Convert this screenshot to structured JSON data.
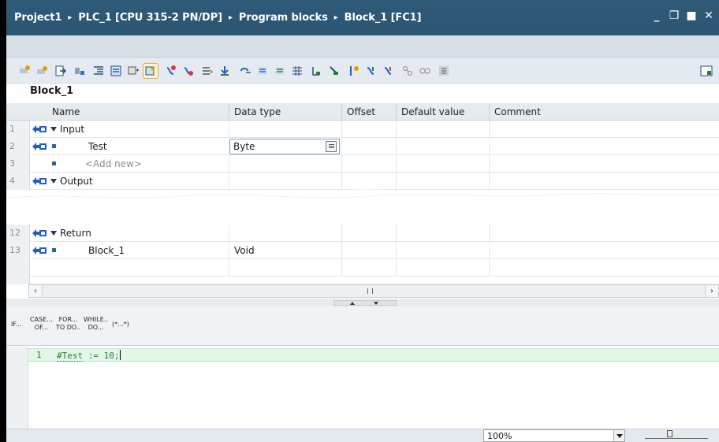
{
  "titlebar": {
    "crumbs": [
      "Project1",
      "PLC_1 [CPU 315-2 PN/DP]",
      "Program blocks",
      "Block_1 [FC1]"
    ],
    "separator": "▸",
    "controls": {
      "minimize": "_",
      "restore": "❐",
      "maximize": "■",
      "close": "✕"
    }
  },
  "block_name": "Block_1",
  "table": {
    "headers": [
      "Name",
      "Data type",
      "Offset",
      "Default value",
      "Comment"
    ],
    "rows": [
      {
        "num": "1",
        "name": "Input",
        "type": ""
      },
      {
        "num": "2",
        "name": "Test",
        "type": "Byte"
      },
      {
        "num": "3",
        "name": "<Add new>",
        "type": ""
      },
      {
        "num": "4",
        "name": "Output",
        "type": ""
      },
      {
        "num": "12",
        "name": "Return",
        "type": ""
      },
      {
        "num": "13",
        "name": "Block_1",
        "type": "Void"
      }
    ]
  },
  "scrollbar": {
    "left": "‹",
    "right": "›"
  },
  "scl_instructions": [
    {
      "top": "IF...",
      "bottom": ""
    },
    {
      "top": "CASE...",
      "bottom": "OF..."
    },
    {
      "top": "FOR...",
      "bottom": "TO DO.."
    },
    {
      "top": "WHILE..",
      "bottom": "DO..."
    },
    {
      "top": "(*...*)",
      "bottom": ""
    }
  ],
  "editor": {
    "line_number": "1",
    "code_var": "#Test",
    "code_rest": " := 10;"
  },
  "status": {
    "zoom": "100%"
  },
  "colors": {
    "titlebar": "#2b5673",
    "code_green": "#2e7d32",
    "line_highlight": "#e2f7e5"
  }
}
